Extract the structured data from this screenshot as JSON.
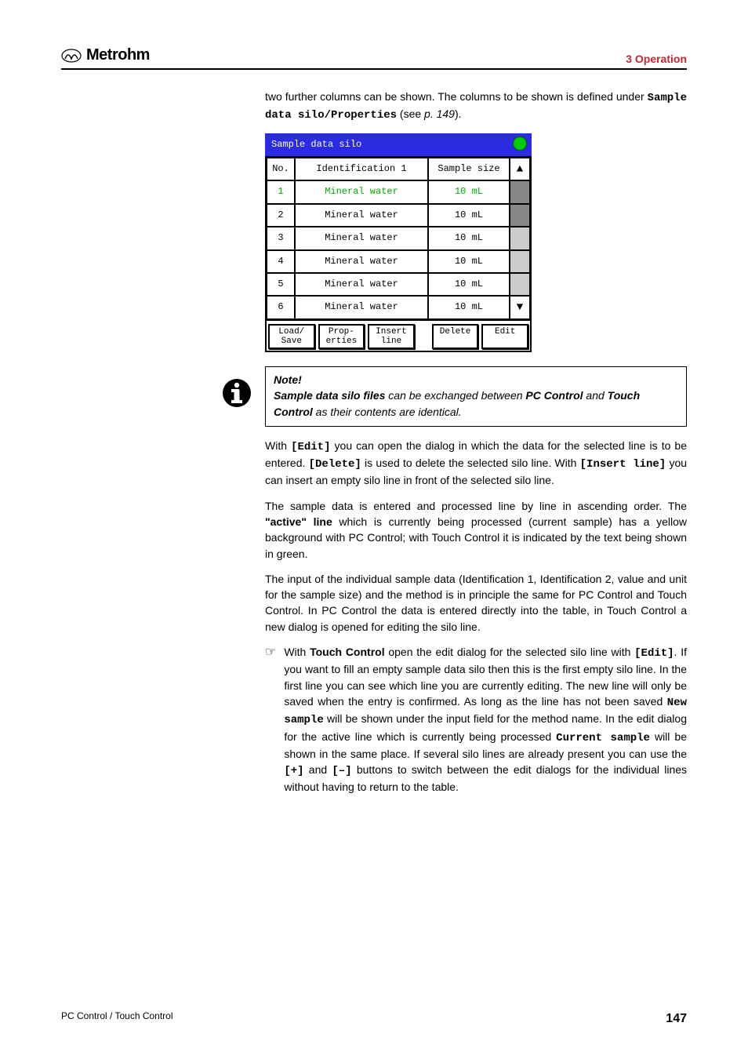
{
  "header": {
    "logo_text": "Metrohm",
    "section": "3 Operation"
  },
  "intro": {
    "line1_a": "two further columns can be shown. The columns to be shown is defined under ",
    "code": "Sample data silo/Properties",
    "line1_b": " (see ",
    "pageref": "p. 149",
    "line1_c": ")."
  },
  "shot": {
    "title": "Sample data silo",
    "headers": {
      "no": "No.",
      "id": "Identification 1",
      "size": "Sample size"
    },
    "rows": [
      {
        "no": "1",
        "id": "Mineral water",
        "size": "10 mL",
        "active": true
      },
      {
        "no": "2",
        "id": "Mineral water",
        "size": "10 mL"
      },
      {
        "no": "3",
        "id": "Mineral water",
        "size": "10 mL"
      },
      {
        "no": "4",
        "id": "Mineral water",
        "size": "10 mL"
      },
      {
        "no": "5",
        "id": "Mineral water",
        "size": "10 mL"
      },
      {
        "no": "6",
        "id": "Mineral water",
        "size": "10 mL"
      }
    ],
    "buttons": {
      "load": "Load/\nSave",
      "props": "Prop-\nerties",
      "insert": "Insert\nline",
      "delete": "Delete",
      "edit": "Edit"
    }
  },
  "note": {
    "heading": "Note!",
    "b1": "Sample data silo files",
    "t1": " can be exchanged between ",
    "b2": "PC Control",
    "t2": " and ",
    "b3": "Touch Control",
    "t3": " as their contents are identical."
  },
  "p1": {
    "a": "With ",
    "edit": "[Edit]",
    "b": " you can open the dialog in which the data for the selected line is to be entered. ",
    "del": "[Delete]",
    "c": " is used to delete the selected silo line. With ",
    "ins": "[Insert line]",
    "d": " you can insert an empty silo line in front of the selected silo line."
  },
  "p2": {
    "a": "The sample data is entered and processed line by line in ascending order. The ",
    "active": "\"active\" line",
    "b": " which is currently being processed (current sample) has a yellow background with PC Control; with Touch Control it is indicated by the text being shown in green."
  },
  "p3": "The input of the individual sample data (Identification 1, Identification 2, value and unit for the sample size) and the method is in principle the same for PC Control and Touch Control. In PC Control the data is entered directly into the table, in Touch Control a new dialog is opened for editing the silo line.",
  "p4": {
    "a": "With ",
    "tc": "Touch Control",
    "b": " open the edit dialog for the selected silo line with ",
    "edit": "[Edit]",
    "c": ". If you want to fill an empty sample data silo then this is the first empty silo line. In the first line you can see which line you are currently editing. The new line will only be saved when the entry is confirmed. As long as the line has not been saved ",
    "new": "New sample",
    "d": " will be shown under the input field for the method name. In the edit dialog for the active line which is currently being processed ",
    "cur": "Current sample",
    "e": " will be shown in the same place. If several silo lines are already present you can use the ",
    "plus": "[+]",
    "f": " and ",
    "minus": "[–]",
    "g": " buttons to switch between the edit dialogs for the individual lines without having to return to the table."
  },
  "footer": {
    "left": "PC Control / Touch Control",
    "page": "147"
  },
  "glyph": {
    "up": "▲",
    "down": "▼",
    "hand": "☞"
  }
}
